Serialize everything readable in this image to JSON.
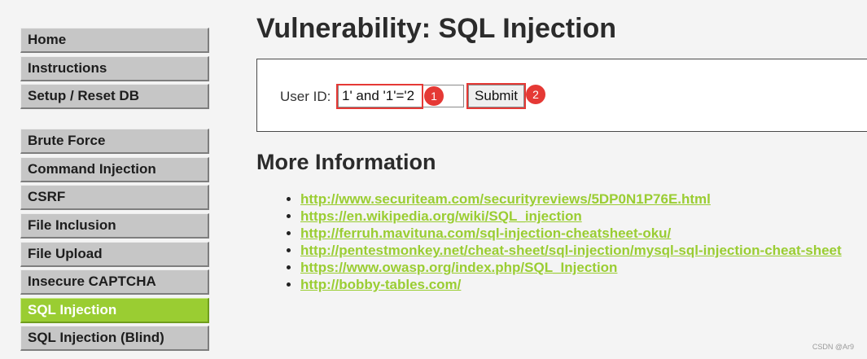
{
  "sidebar": {
    "group1": [
      {
        "label": "Home"
      },
      {
        "label": "Instructions"
      },
      {
        "label": "Setup / Reset DB"
      }
    ],
    "group2": [
      {
        "label": "Brute Force"
      },
      {
        "label": "Command Injection"
      },
      {
        "label": "CSRF"
      },
      {
        "label": "File Inclusion"
      },
      {
        "label": "File Upload"
      },
      {
        "label": "Insecure CAPTCHA"
      },
      {
        "label": "SQL Injection",
        "active": true
      },
      {
        "label": "SQL Injection (Blind)"
      }
    ]
  },
  "main": {
    "title": "Vulnerability: SQL Injection",
    "form": {
      "user_id_label": "User ID:",
      "user_id_value": "1' and '1'='2",
      "submit_label": "Submit",
      "marker_input": "1",
      "marker_submit": "2"
    },
    "more_info": {
      "heading": "More Information",
      "links": [
        "http://www.securiteam.com/securityreviews/5DP0N1P76E.html",
        "https://en.wikipedia.org/wiki/SQL_injection",
        "http://ferruh.mavituna.com/sql-injection-cheatsheet-oku/",
        "http://pentestmonkey.net/cheat-sheet/sql-injection/mysql-sql-injection-cheat-sheet",
        "https://www.owasp.org/index.php/SQL_Injection",
        "http://bobby-tables.com/"
      ]
    }
  },
  "watermark": "CSDN @Ar9",
  "colors": {
    "accent": "#9acd32",
    "highlight": "#e53935",
    "menu_bg": "#c6c6c6"
  }
}
